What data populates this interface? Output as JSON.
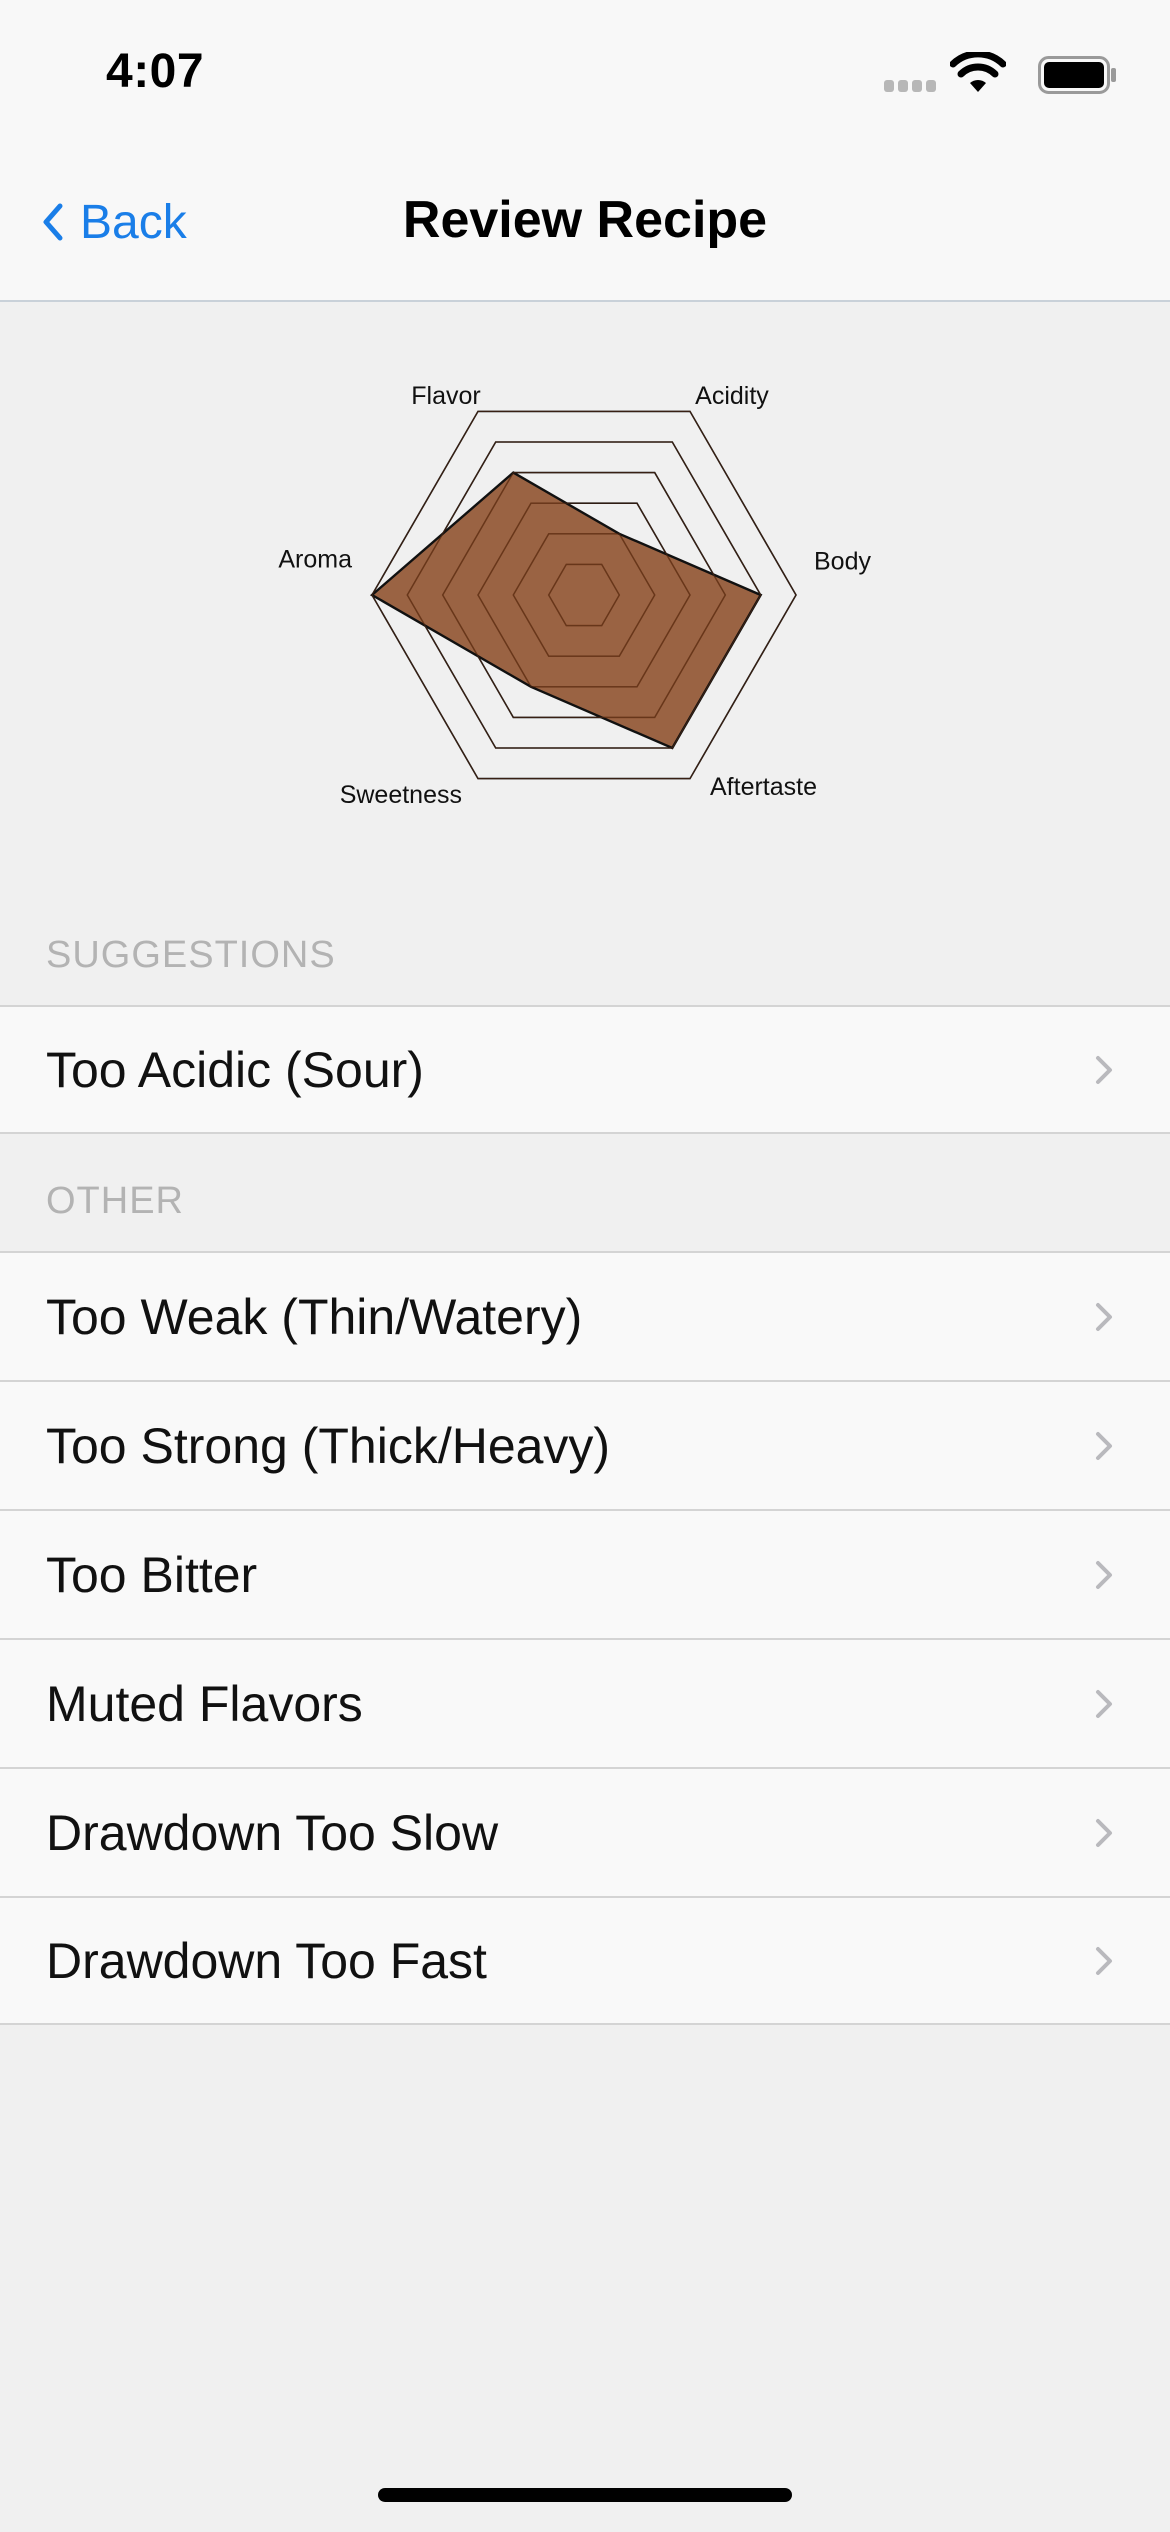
{
  "status_bar": {
    "time": "4:07",
    "icons": [
      "cellular-signal-icon",
      "wifi-icon",
      "battery-icon"
    ]
  },
  "nav": {
    "back_label": "Back",
    "title": "Review Recipe"
  },
  "chart_data": {
    "type": "radar",
    "axes": [
      "Flavor",
      "Acidity",
      "Body",
      "Aftertaste",
      "Sweetness",
      "Aroma"
    ],
    "values": [
      4,
      2,
      5,
      5,
      3,
      6
    ],
    "rings": 6,
    "max": 6,
    "fill_color": "#8b4a24",
    "fill_opacity": 0.85
  },
  "sections": {
    "suggestions": {
      "header": "SUGGESTIONS",
      "items": [
        "Too Acidic (Sour)"
      ]
    },
    "other": {
      "header": "OTHER",
      "items": [
        "Too Weak (Thin/Watery)",
        "Too Strong (Thick/Heavy)",
        "Too Bitter",
        "Muted Flavors",
        "Drawdown Too Slow",
        "Drawdown Too Fast"
      ]
    }
  },
  "colors": {
    "accent": "#1a7ee8",
    "background": "#f0f0f0",
    "section_header": "#b3b3b3"
  }
}
